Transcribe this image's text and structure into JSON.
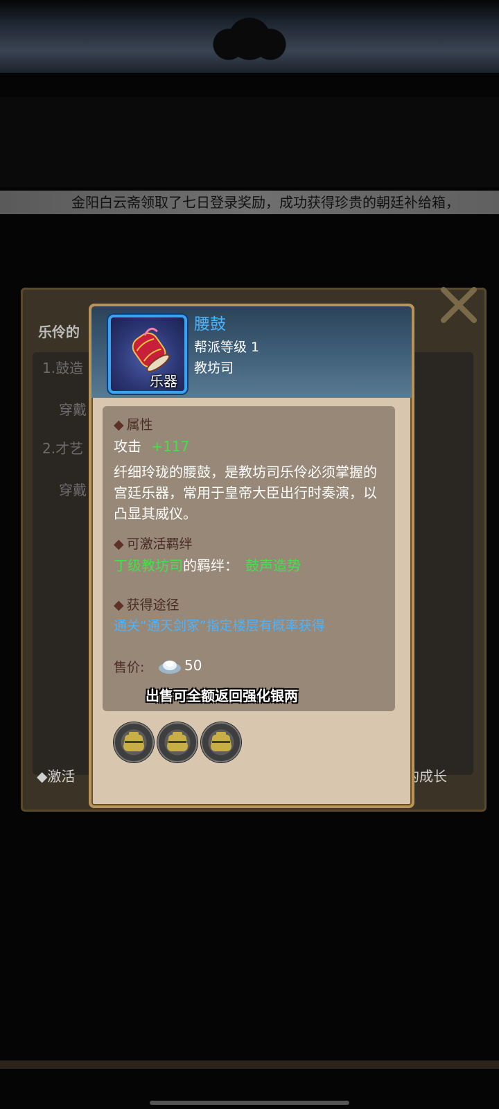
{
  "marquee": {
    "text": "金阳白云斋领取了七日登录奖励，成功获得珍贵的朝廷补给箱，"
  },
  "back_panel": {
    "subtitle": "乐伶的",
    "items": [
      {
        "label": "1.鼓造",
        "sub": "穿戴"
      },
      {
        "label": "2.才艺",
        "sub": "穿戴"
      }
    ],
    "footer_left": "◆激活",
    "footer_right": "的成长"
  },
  "item": {
    "name": "腰鼓",
    "category": "乐器",
    "level": "帮派等级 1",
    "guild": "教坊司"
  },
  "attributes": {
    "title": "属性",
    "stat_label": "攻击",
    "stat_value": "+117",
    "description": "纤细玲珑的腰鼓，是教坊司乐伶必须掌握的宫廷乐器，常用于皇帝大臣出行时奏演，以凸显其威仪。"
  },
  "bond": {
    "title": "可激活羁绊",
    "target": "丁级教坊司",
    "middle": "的羁绊：",
    "name": "鼓声造势"
  },
  "source": {
    "title": "获得途径",
    "text": "通关“通天剑冢”指定楼层有概率获得"
  },
  "sell": {
    "label": "售价:",
    "value": "50",
    "note": "出售可全额返回强化银两"
  },
  "slots_count": 3,
  "colors": {
    "accent_blue": "#4cb3ff",
    "accent_green": "#44e04c",
    "frame_gold": "#b8935a",
    "card_bg": "#d8c6ae",
    "info_bg": "#978877"
  },
  "icons": {
    "item": "waist-drum-icon",
    "currency": "silver-ingot-icon",
    "slot": "locked-slot-icon",
    "close": "close-x-icon"
  }
}
